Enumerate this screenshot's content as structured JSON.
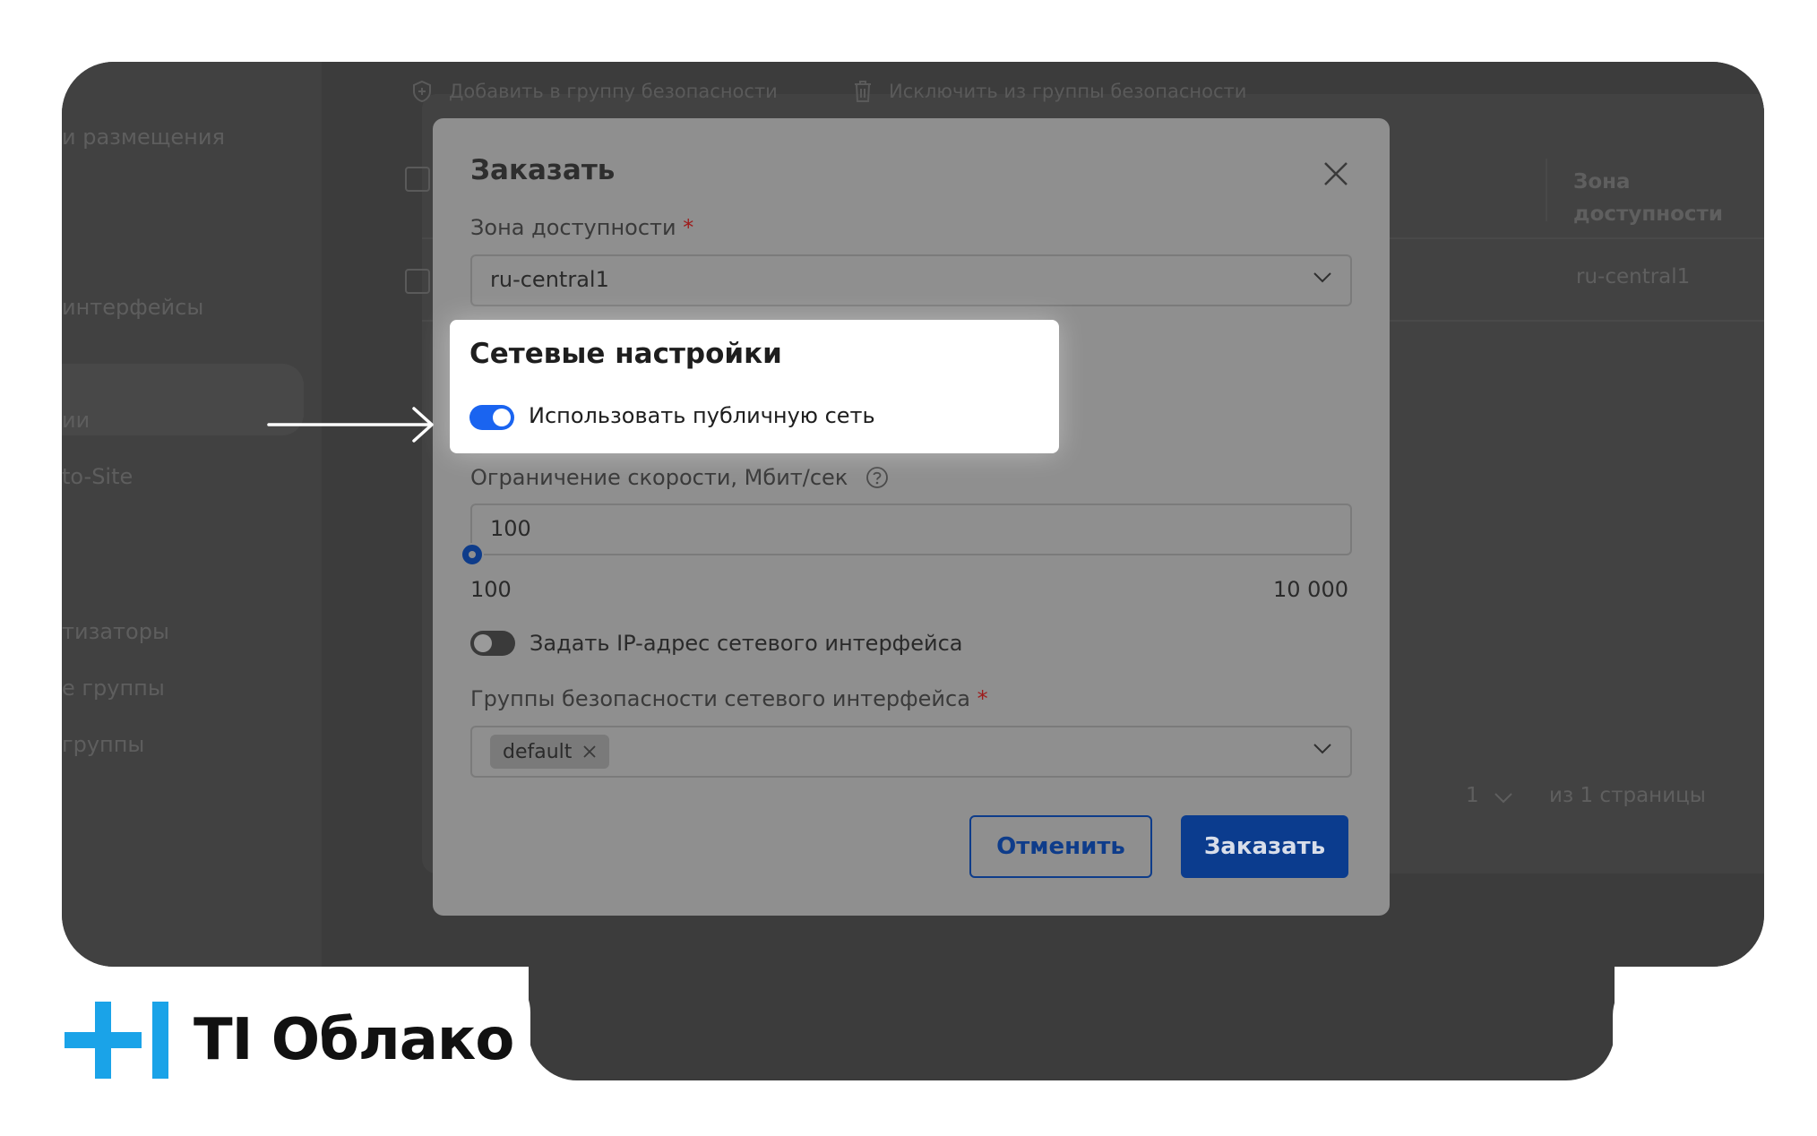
{
  "sidebar": {
    "items": [
      "и размещения",
      "интерфейсы",
      "ии",
      "to-Site",
      "тизаторы",
      "е группы",
      "группы"
    ],
    "active_index": 1
  },
  "toolbar": {
    "add_to_group": "Добавить в группу безопасности",
    "remove_from_group": "Исключить из группы безопасности"
  },
  "table": {
    "column_zone": "Зона доступности",
    "row_zone": "ru-central1"
  },
  "pagination": {
    "page": "1",
    "of_pages": "из 1 страницы"
  },
  "modal": {
    "title": "Заказать",
    "zone_label": "Зона доступности",
    "zone_value": "ru-central1",
    "network_section_title": "Сетевые настройки",
    "public_network_label": "Использовать публичную сеть",
    "public_network_on": true,
    "speed_label": "Ограничение скорости, Мбит/сек",
    "speed_value": "100",
    "slider_min": "100",
    "slider_max": "10 000",
    "slider_fraction": 0.0,
    "set_ip_label": "Задать IP-адрес сетевого интерфейса",
    "set_ip_on": false,
    "security_groups_label": "Группы безопасности сетевого интерфейса",
    "security_groups_chip": "default",
    "required_mark": "*",
    "cancel_label": "Отменить",
    "order_label": "Заказать"
  },
  "brand": {
    "name": "TI Облако",
    "accent_color": "#1aa3e8",
    "primary_color": "#0b3c8e"
  },
  "icons": [
    "shield-plus-icon",
    "trash-icon",
    "close-icon",
    "chevron-down-icon",
    "help-icon",
    "chip-close-icon",
    "arrow-right-icon",
    "brand-logo-icon"
  ]
}
